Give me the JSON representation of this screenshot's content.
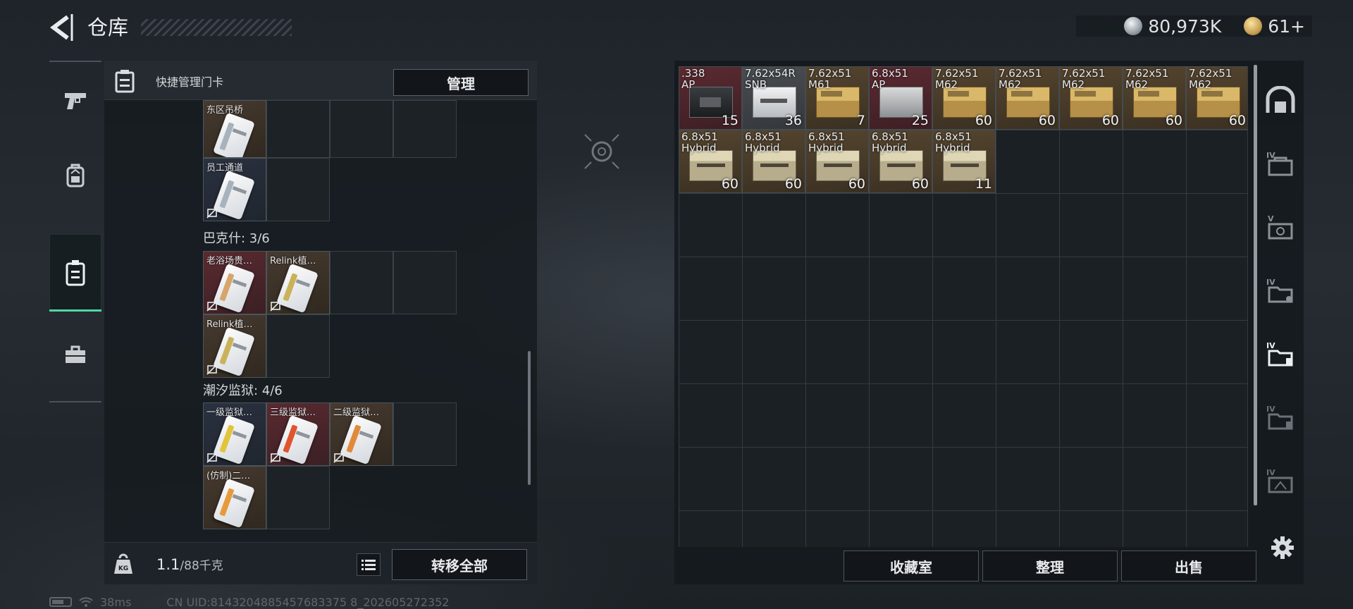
{
  "header": {
    "title": "仓库",
    "back_icon": "back-arrow-icon",
    "currency": [
      {
        "icon": "silver-coin-icon",
        "value": "80,973K"
      },
      {
        "icon": "gold-coin-icon",
        "value": "61+"
      }
    ]
  },
  "sidebar": {
    "items": [
      {
        "name": "weapons",
        "icon": "pistol-icon",
        "active": false
      },
      {
        "name": "equipment",
        "icon": "backpack-icon",
        "active": false
      },
      {
        "name": "keycards",
        "icon": "keycard-holder-icon",
        "active": true
      },
      {
        "name": "supplies",
        "icon": "toolbox-icon",
        "active": false
      }
    ]
  },
  "left_panel": {
    "header_title": "快捷管理门卡",
    "manage_label": "管理",
    "groups": [
      {
        "title": "",
        "cards": [
          {
            "label": "东区吊桥",
            "color": "brown",
            "no_drop": false
          },
          {
            "label": "员工通道",
            "color": "blue",
            "no_drop": true
          }
        ]
      },
      {
        "title": "巴克什: 3/6",
        "cards": [
          {
            "label": "老浴场贵…",
            "color": "red",
            "no_drop": true
          },
          {
            "label": "Relink植…",
            "color": "brown",
            "no_drop": true
          },
          {
            "label": "Relink植…",
            "color": "brown",
            "no_drop": true
          }
        ]
      },
      {
        "title": "潮汐监狱: 4/6",
        "cards": [
          {
            "label": "一级监狱…",
            "color": "blue",
            "no_drop": true
          },
          {
            "label": "三级监狱…",
            "color": "red",
            "no_drop": true
          },
          {
            "label": "二级监狱…",
            "color": "brown",
            "no_drop": true
          },
          {
            "label": "(仿制)二…",
            "color": "brown",
            "no_drop": false
          }
        ]
      }
    ],
    "footer": {
      "weight_current": "1.1",
      "weight_max": "/88千克",
      "transfer_label": "转移全部"
    }
  },
  "stash": {
    "items": [
      {
        "name": ".338\nAP",
        "qty": "15",
        "color": "red",
        "box": "black"
      },
      {
        "name": "7.62x54R\nSNB",
        "qty": "36",
        "color": "grey",
        "box": "white"
      },
      {
        "name": "7.62x51\nM61",
        "qty": "7",
        "color": "brown",
        "box": "yellow"
      },
      {
        "name": "6.8x51\nAP",
        "qty": "25",
        "color": "red",
        "box": "gray"
      },
      {
        "name": "7.62x51\nM62",
        "qty": "60",
        "color": "brown",
        "box": "yellow"
      },
      {
        "name": "7.62x51\nM62",
        "qty": "60",
        "color": "brown",
        "box": "yellow"
      },
      {
        "name": "7.62x51\nM62",
        "qty": "60",
        "color": "brown",
        "box": "yellow"
      },
      {
        "name": "7.62x51\nM62",
        "qty": "60",
        "color": "brown",
        "box": "yellow"
      },
      {
        "name": "7.62x51\nM62",
        "qty": "60",
        "color": "brown",
        "box": "yellow"
      },
      {
        "name": "6.8x51\nHybrid",
        "qty": "60",
        "color": "brown",
        "box": "pack"
      },
      {
        "name": "6.8x51\nHybrid",
        "qty": "60",
        "color": "brown",
        "box": "pack"
      },
      {
        "name": "6.8x51\nHybrid",
        "qty": "60",
        "color": "brown",
        "box": "pack"
      },
      {
        "name": "6.8x51\nHybrid",
        "qty": "60",
        "color": "brown",
        "box": "pack"
      },
      {
        "name": "6.8x51\nHybrid",
        "qty": "11",
        "color": "brown",
        "box": "pack"
      }
    ],
    "buttons": {
      "collection": "收藏室",
      "sort": "整理",
      "sell": "出售"
    },
    "tabs": [
      {
        "label": "",
        "icon": "stash-main-icon"
      },
      {
        "label": "IV",
        "icon": "case-iv-icon"
      },
      {
        "label": "V",
        "icon": "case-v-icon"
      },
      {
        "label": "IV",
        "icon": "case-iv-lock-icon"
      },
      {
        "label": "IV",
        "icon": "case-iv-active-icon"
      },
      {
        "label": "IV",
        "icon": "case-iv-dim-icon"
      },
      {
        "label": "IV",
        "icon": "case-iv-alt-icon"
      }
    ],
    "settings_icon": "gear-icon"
  },
  "status_bar": {
    "ping": "38ms",
    "uid": "CN UID:8143204885457683375 8_202605272352"
  },
  "colors": {
    "accent": "#4fd7a6",
    "card_red": "#5b2a31",
    "card_brown": "#55452f",
    "card_blue": "#2a3140"
  }
}
